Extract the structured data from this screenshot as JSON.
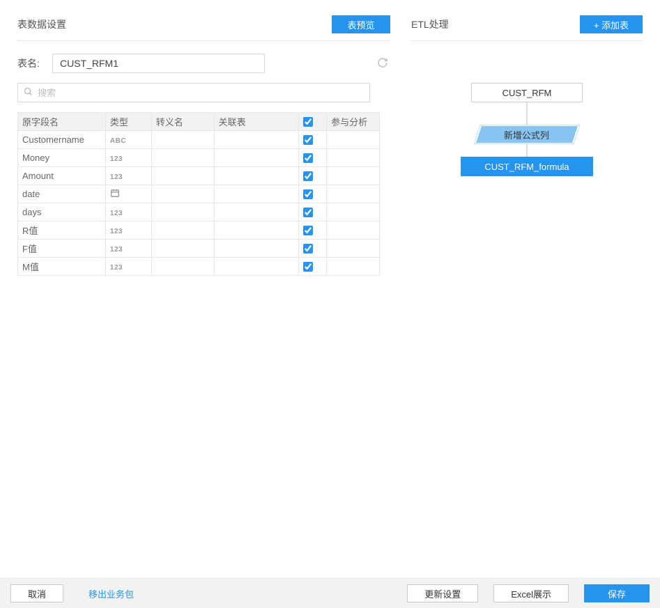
{
  "left": {
    "title": "表数据设置",
    "preview_btn": "表预览",
    "tablename_label": "表名:",
    "tablename_value": "CUST_RFM1",
    "search_placeholder": "搜索",
    "columns": {
      "name": "原字段名",
      "type": "类型",
      "alias": "转义名",
      "rel": "关联表",
      "analysis": "参与分析"
    },
    "header_checked": true,
    "rows": [
      {
        "name": "Customername",
        "type": "ABC",
        "alias": "",
        "rel": "",
        "checked": true
      },
      {
        "name": "Money",
        "type": "123",
        "alias": "",
        "rel": "",
        "checked": true
      },
      {
        "name": "Amount",
        "type": "123",
        "alias": "",
        "rel": "",
        "checked": true
      },
      {
        "name": "date",
        "type": "DATE",
        "alias": "",
        "rel": "",
        "checked": true
      },
      {
        "name": "days",
        "type": "123",
        "alias": "",
        "rel": "",
        "checked": true
      },
      {
        "name": "R值",
        "type": "123",
        "alias": "",
        "rel": "",
        "checked": true
      },
      {
        "name": "F值",
        "type": "123",
        "alias": "",
        "rel": "",
        "checked": true
      },
      {
        "name": "M值",
        "type": "123",
        "alias": "",
        "rel": "",
        "checked": true
      }
    ]
  },
  "right": {
    "title": "ETL处理",
    "add_btn": "+ 添加表",
    "node1": "CUST_RFM",
    "node_formula": "新增公式列",
    "node2": "CUST_RFM_formula"
  },
  "footer": {
    "cancel": "取消",
    "moveout": "移出业务包",
    "refresh_config": "更新设置",
    "excel": "Excel展示",
    "save": "保存"
  }
}
